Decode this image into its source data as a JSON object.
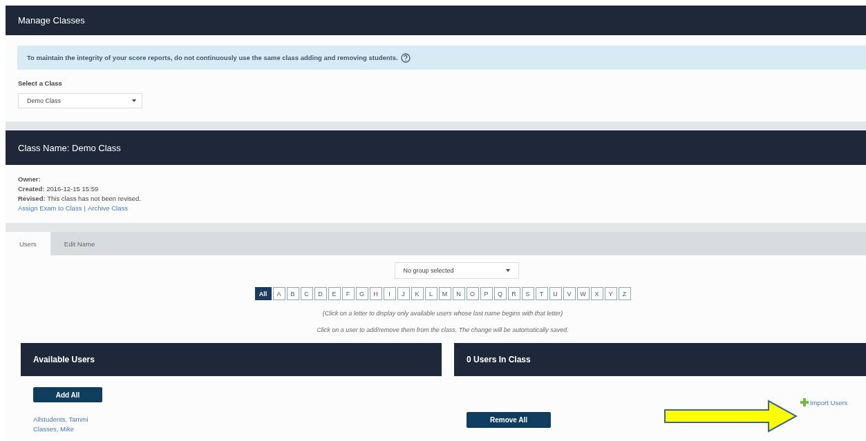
{
  "header": {
    "title": "Manage Classes"
  },
  "alert": {
    "text": "To maintain the integrity of your score reports, do not continuously use the same class adding and removing students."
  },
  "class_select": {
    "label": "Select a Class",
    "value": "Demo Class"
  },
  "class_panel": {
    "title": "Class Name: Demo Class"
  },
  "details": [
    {
      "label": "Owner:"
    },
    {
      "label": "Created:",
      "value": "2016-12-15 15:59"
    },
    {
      "label": "Revised:",
      "value": "This class has not been revised."
    }
  ],
  "links": [
    "Assign Exam to Class",
    "Archive Class"
  ],
  "link_separator": "|",
  "tabs": [
    {
      "label": "Users",
      "selected": true
    },
    {
      "label": "Edit Name",
      "selected": false
    }
  ],
  "group_select": {
    "value": "No group selected"
  },
  "letters": [
    {
      "label": "All",
      "selected": true
    },
    {
      "label": "A",
      "selected": false
    },
    {
      "label": "B",
      "selected": false
    },
    {
      "label": "C",
      "selected": false
    },
    {
      "label": "D",
      "selected": false
    },
    {
      "label": "E",
      "selected": false
    },
    {
      "label": "F",
      "selected": false
    },
    {
      "label": "G",
      "selected": false
    },
    {
      "label": "H",
      "selected": false
    },
    {
      "label": "I",
      "selected": false
    },
    {
      "label": "J",
      "selected": false
    },
    {
      "label": "K",
      "selected": false
    },
    {
      "label": "L",
      "selected": false
    },
    {
      "label": "M",
      "selected": false
    },
    {
      "label": "N",
      "selected": false
    },
    {
      "label": "O",
      "selected": false
    },
    {
      "label": "P",
      "selected": false
    },
    {
      "label": "Q",
      "selected": false
    },
    {
      "label": "R",
      "selected": false
    },
    {
      "label": "S",
      "selected": false
    },
    {
      "label": "T",
      "selected": false
    },
    {
      "label": "U",
      "selected": false
    },
    {
      "label": "V",
      "selected": false
    },
    {
      "label": "W",
      "selected": false
    },
    {
      "label": "X",
      "selected": false
    },
    {
      "label": "Y",
      "selected": false
    },
    {
      "label": "Z",
      "selected": false
    }
  ],
  "hints": [
    "(Click on a letter to display only available users whose last name begins with that letter)",
    "Click on a user to add/remove them from the class. The change will be automatically saved."
  ],
  "available": {
    "title": "Available Users",
    "button": "Add All",
    "users": [
      "Allstudents, Tammi",
      "Classes, Mike"
    ]
  },
  "in_class": {
    "title": "0 Users In Class",
    "button": "Remove All",
    "import": "Import Users"
  }
}
